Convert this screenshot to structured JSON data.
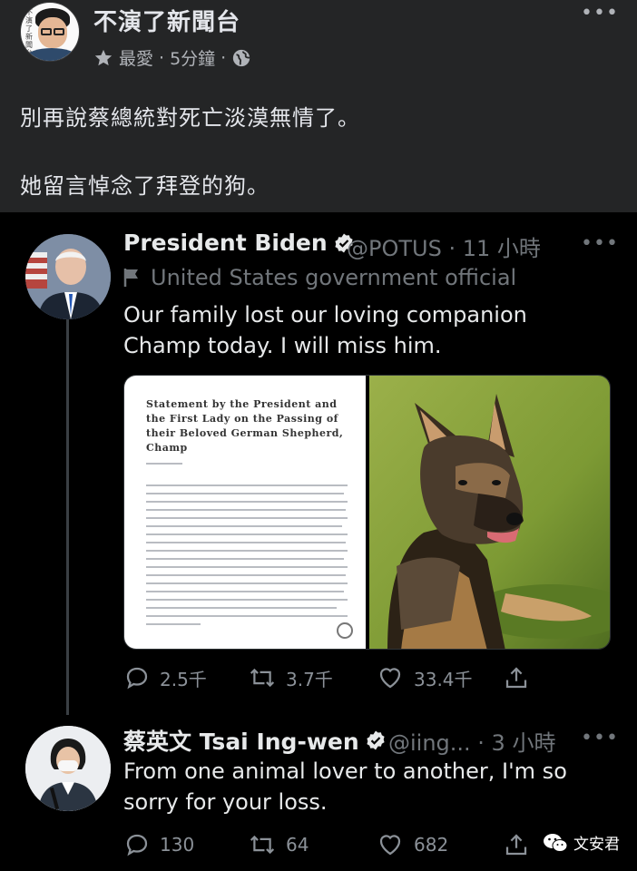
{
  "facebook": {
    "page_name": "不演了新聞台",
    "meta_fav": "最愛",
    "meta_sep": "·",
    "meta_time": "5分鐘",
    "avatar_side_text": "不演了新聞台",
    "more": "•••",
    "text_line1": "別再說蔡總統對死亡淡漠無情了。",
    "text_line2": "她留言悼念了拜登的狗。"
  },
  "tweet_main": {
    "name": "President Biden",
    "handle": "@POTUS · 11 小時",
    "label": "United States government official",
    "text_line1": "Our family lost our loving companion",
    "text_line2": "Champ today. I will miss him.",
    "more": "•••",
    "statement_title": "Statement by the President and the First Lady on the Passing of their Beloved German Shepherd, Champ",
    "replies": "2.5千",
    "retweets": "3.7千",
    "likes": "33.4千"
  },
  "tweet_reply": {
    "name": "蔡英文 Tsai Ing-wen",
    "handle": "@iing... · 3 小時",
    "text_line1": "From one animal lover to another, I'm so",
    "text_line2": "sorry for your loss.",
    "more": "•••",
    "replies": "130",
    "retweets": "64",
    "likes": "682"
  },
  "watermark": {
    "text": "文安君"
  },
  "colors": {
    "fb_bg": "#242526",
    "tw_bg": "#000000",
    "verified": "#e7e9ea",
    "muted": "#71767b"
  },
  "icons": [
    "star-icon",
    "globe-icon",
    "verified-icon",
    "flag-icon",
    "reply-icon",
    "retweet-icon",
    "like-icon",
    "share-icon",
    "wechat-icon"
  ]
}
